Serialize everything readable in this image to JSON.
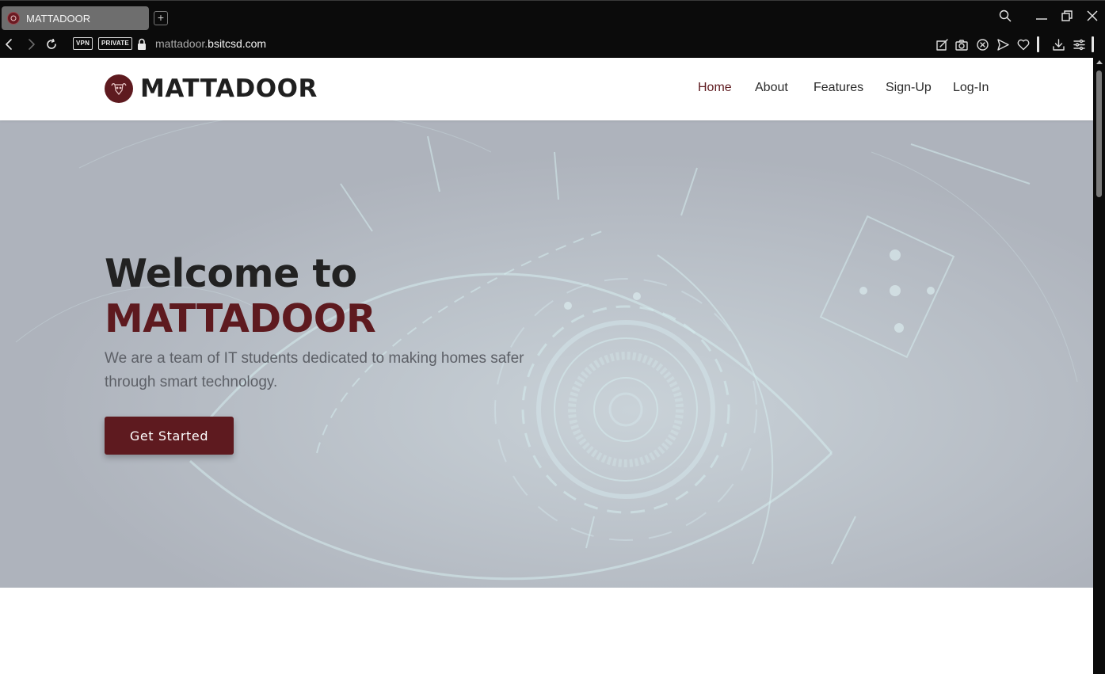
{
  "browser": {
    "tab_title": "MATTADOOR",
    "new_tab_label": "+",
    "vpn_badge": "VPN",
    "private_badge": "PRIVATE",
    "url_prefix": "mattadoor.",
    "url_domain": "bsitcsd.com"
  },
  "site": {
    "logo_text": "MATTADOOR",
    "nav": [
      {
        "label": "Home",
        "active": true
      },
      {
        "label": "About",
        "active": false
      },
      {
        "label": "Features",
        "active": false
      },
      {
        "label": "Sign-Up",
        "active": false
      },
      {
        "label": "Log-In",
        "active": false
      }
    ]
  },
  "hero": {
    "title_line1": "Welcome to",
    "title_line2": "MATTADOOR",
    "subtitle": "We are a team of IT students dedicated to making homes safer through smart technology.",
    "cta_label": "Get Started"
  },
  "colors": {
    "brand": "#5e1a1f",
    "hero_bg": "#b2b7c0",
    "chrome_bg": "#0b0b0b"
  }
}
